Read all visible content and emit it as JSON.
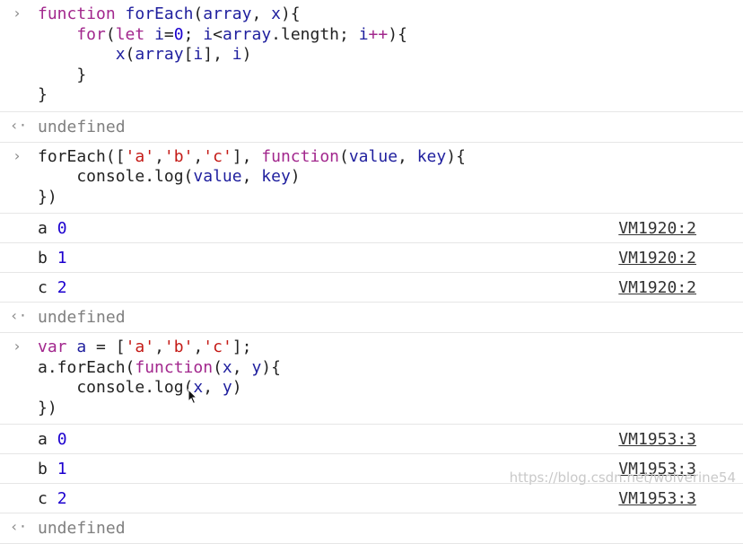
{
  "console": {
    "entries": [
      {
        "type": "input",
        "gutter": "›",
        "lines": [
          [
            {
              "t": "function ",
              "c": "kw"
            },
            {
              "t": "forEach",
              "c": "fn"
            },
            {
              "t": "(",
              "c": "plain"
            },
            {
              "t": "array",
              "c": "fn"
            },
            {
              "t": ", ",
              "c": "plain"
            },
            {
              "t": "x",
              "c": "fn"
            },
            {
              "t": "){",
              "c": "plain"
            }
          ],
          [
            {
              "t": "    for",
              "c": "kw"
            },
            {
              "t": "(",
              "c": "plain"
            },
            {
              "t": "let ",
              "c": "kw"
            },
            {
              "t": "i",
              "c": "fn"
            },
            {
              "t": "=",
              "c": "plain"
            },
            {
              "t": "0",
              "c": "num"
            },
            {
              "t": "; ",
              "c": "plain"
            },
            {
              "t": "i",
              "c": "fn"
            },
            {
              "t": "<",
              "c": "plain"
            },
            {
              "t": "array",
              "c": "fn"
            },
            {
              "t": ".length; ",
              "c": "plain"
            },
            {
              "t": "i",
              "c": "fn"
            },
            {
              "t": "++",
              "c": "kw"
            },
            {
              "t": "){",
              "c": "plain"
            }
          ],
          [
            {
              "t": "        x",
              "c": "fn"
            },
            {
              "t": "(",
              "c": "plain"
            },
            {
              "t": "array",
              "c": "fn"
            },
            {
              "t": "[",
              "c": "plain"
            },
            {
              "t": "i",
              "c": "fn"
            },
            {
              "t": "], ",
              "c": "plain"
            },
            {
              "t": "i",
              "c": "fn"
            },
            {
              "t": ")",
              "c": "plain"
            }
          ],
          [
            {
              "t": "    }",
              "c": "plain"
            }
          ],
          [
            {
              "t": "}",
              "c": "plain"
            }
          ]
        ]
      },
      {
        "type": "result",
        "gutter": "‹·",
        "text": "undefined"
      },
      {
        "type": "input",
        "gutter": "›",
        "lines": [
          [
            {
              "t": "forEach([",
              "c": "plain"
            },
            {
              "t": "'a'",
              "c": "str"
            },
            {
              "t": ",",
              "c": "plain"
            },
            {
              "t": "'b'",
              "c": "str"
            },
            {
              "t": ",",
              "c": "plain"
            },
            {
              "t": "'c'",
              "c": "str"
            },
            {
              "t": "], ",
              "c": "plain"
            },
            {
              "t": "function",
              "c": "kw"
            },
            {
              "t": "(",
              "c": "plain"
            },
            {
              "t": "value",
              "c": "fn"
            },
            {
              "t": ", ",
              "c": "plain"
            },
            {
              "t": "key",
              "c": "fn"
            },
            {
              "t": "){",
              "c": "plain"
            }
          ],
          [
            {
              "t": "    console.log(",
              "c": "plain"
            },
            {
              "t": "value",
              "c": "fn"
            },
            {
              "t": ", ",
              "c": "plain"
            },
            {
              "t": "key",
              "c": "fn"
            },
            {
              "t": ")",
              "c": "plain"
            }
          ],
          [
            {
              "t": "})",
              "c": "plain"
            }
          ]
        ]
      },
      {
        "type": "log",
        "text": "a",
        "num": "0",
        "source": "VM1920:2"
      },
      {
        "type": "log",
        "text": "b",
        "num": "1",
        "source": "VM1920:2"
      },
      {
        "type": "log",
        "text": "c",
        "num": "2",
        "source": "VM1920:2"
      },
      {
        "type": "result",
        "gutter": "‹·",
        "text": "undefined"
      },
      {
        "type": "input",
        "gutter": "›",
        "lines": [
          [
            {
              "t": "var ",
              "c": "kw"
            },
            {
              "t": "a",
              "c": "fn"
            },
            {
              "t": " = [",
              "c": "plain"
            },
            {
              "t": "'a'",
              "c": "str"
            },
            {
              "t": ",",
              "c": "plain"
            },
            {
              "t": "'b'",
              "c": "str"
            },
            {
              "t": ",",
              "c": "plain"
            },
            {
              "t": "'c'",
              "c": "str"
            },
            {
              "t": "];",
              "c": "plain"
            }
          ],
          [
            {
              "t": "a.forEach(",
              "c": "plain"
            },
            {
              "t": "function",
              "c": "kw"
            },
            {
              "t": "(",
              "c": "plain"
            },
            {
              "t": "x",
              "c": "fn"
            },
            {
              "t": ", ",
              "c": "plain"
            },
            {
              "t": "y",
              "c": "fn"
            },
            {
              "t": "){",
              "c": "plain"
            }
          ],
          [
            {
              "t": "    console.log(",
              "c": "plain"
            },
            {
              "t": "x",
              "c": "fn"
            },
            {
              "t": ", ",
              "c": "plain"
            },
            {
              "t": "y",
              "c": "fn"
            },
            {
              "t": ")",
              "c": "plain"
            }
          ],
          [
            {
              "t": "})",
              "c": "plain"
            }
          ]
        ]
      },
      {
        "type": "log",
        "text": "a",
        "num": "0",
        "source": "VM1953:3"
      },
      {
        "type": "log",
        "text": "b",
        "num": "1",
        "source": "VM1953:3"
      },
      {
        "type": "log",
        "text": "c",
        "num": "2",
        "source": "VM1953:3"
      },
      {
        "type": "result",
        "gutter": "‹·",
        "text": "undefined"
      }
    ]
  },
  "watermark": "https://blog.csdn.net/wolverine54"
}
